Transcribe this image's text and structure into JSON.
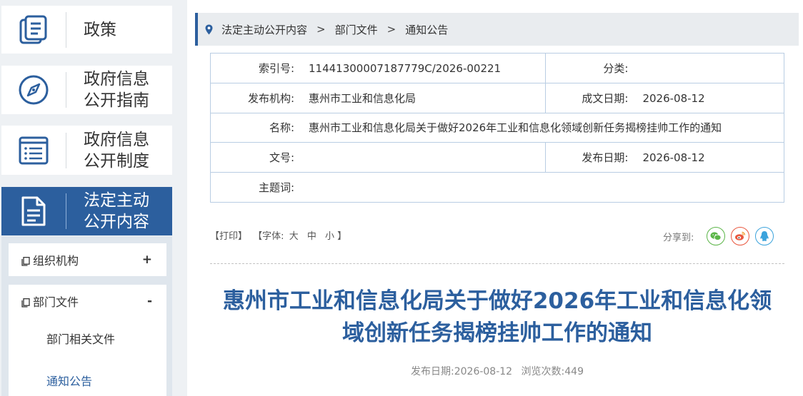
{
  "sidebar": {
    "cards": [
      {
        "line1": "政策",
        "line2": ""
      },
      {
        "line1": "政府信息",
        "line2": "公开指南"
      },
      {
        "line1": "政府信息",
        "line2": "公开制度"
      },
      {
        "line1": "法定主动",
        "line2": "公开内容"
      }
    ],
    "sub_items": [
      {
        "label": "组织机构",
        "toggle": "+"
      },
      {
        "label": "部门文件",
        "toggle": "-"
      }
    ],
    "children": [
      "部门相关文件",
      "通知公告"
    ]
  },
  "breadcrumb": {
    "items": [
      "法定主动公开内容",
      "部门文件",
      "通知公告"
    ],
    "separator": ">"
  },
  "meta": {
    "index_label": "索引号:",
    "index_value": "11441300007187779C/2026-00221",
    "category_label": "分类:",
    "category_value": "",
    "publisher_label": "发布机构:",
    "publisher_value": "惠州市工业和信息化局",
    "written_date_label": "成文日期:",
    "written_date_value": "2026-08-12",
    "name_label": "名称:",
    "name_value": "惠州市工业和信息化局关于做好2026年工业和信息化领域创新任务揭榜挂帅工作的通知",
    "docno_label": "文号:",
    "docno_value": "",
    "pub_date_label": "发布日期:",
    "pub_date_value": "2026-08-12",
    "subject_label": "主题词:",
    "subject_value": ""
  },
  "tools": {
    "print": "【打印】",
    "font_prefix": "【字体:",
    "font_large": "大",
    "font_medium": "中",
    "font_small": "小",
    "font_suffix": "】",
    "share_label": "分享到:"
  },
  "article": {
    "title_line1": "惠州市工业和信息化局关于做好2026年工业和信息化领",
    "title_line2": "域创新任务揭榜挂帅工作的通知",
    "pub_date_label": "发布日期:",
    "pub_date": "2026-08-12",
    "views_label": "浏览次数:",
    "views": "449"
  },
  "colors": {
    "accent": "#2c5f9e",
    "wechat": "#5bb548",
    "weibo": "#e9573e",
    "qq": "#3ba3dc"
  }
}
